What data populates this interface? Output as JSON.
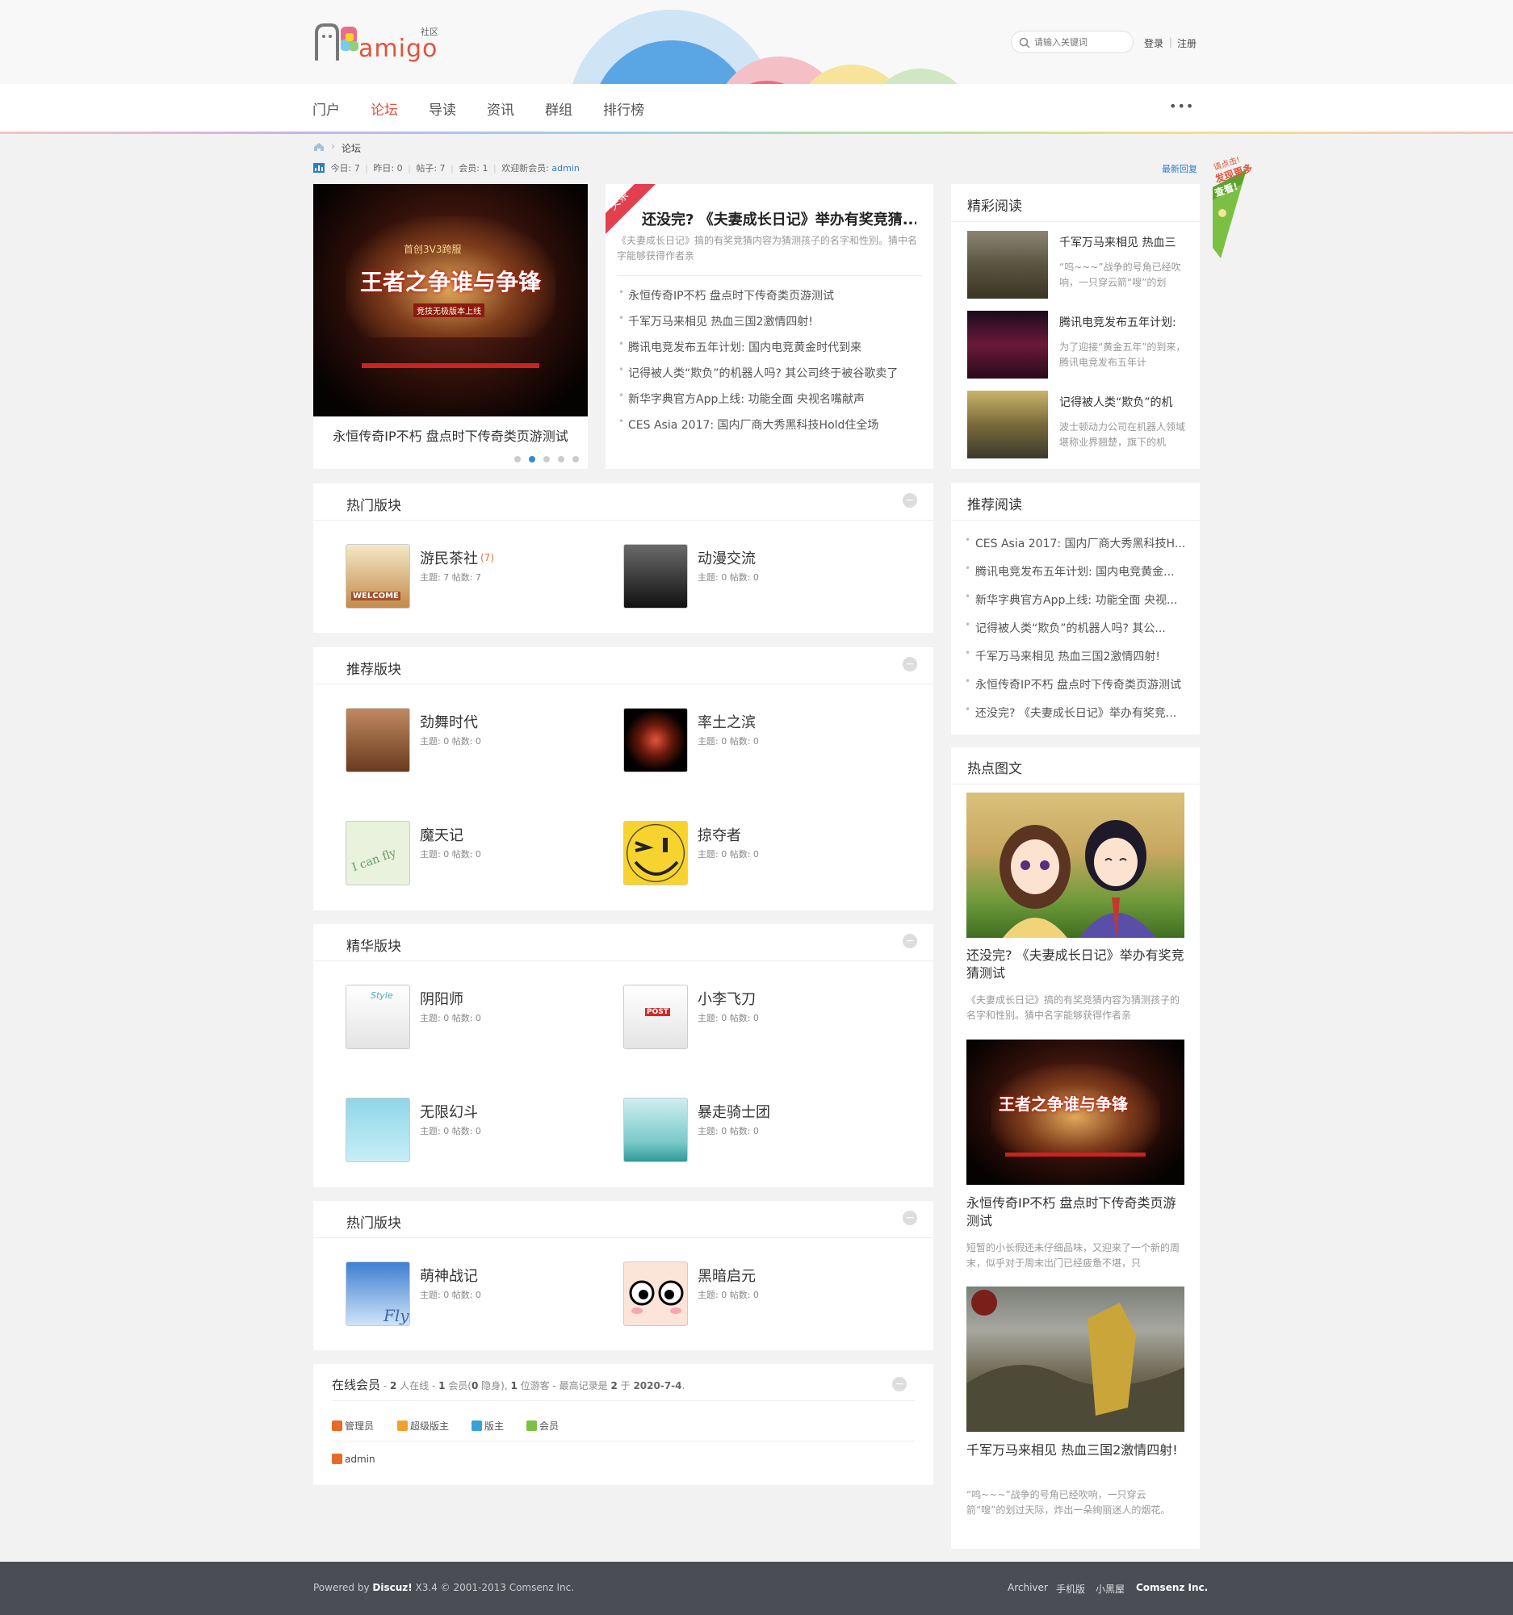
{
  "header": {
    "logo_text": "amigo",
    "logo_sub": "社区",
    "search_placeholder": "请输入关键词",
    "login": "登录",
    "divider": "|",
    "register": "注册"
  },
  "nav": {
    "items": [
      "门户",
      "论坛",
      "导读",
      "资讯",
      "群组",
      "排行榜"
    ],
    "active": "论坛",
    "more": "•••"
  },
  "breadcrumb": {
    "current": "论坛",
    "separator": "›"
  },
  "stats": {
    "text_today": "今日: 7",
    "text_yesterday": "昨日: 0",
    "text_posts": "帖子: 7",
    "text_members": "会员: 1",
    "text_welcome": "欢迎新会员:",
    "new_member": "admin",
    "latest_reply": "最新回复",
    "sep": "|"
  },
  "side_badge": {
    "line1": "请点击!",
    "line2": "发现更多",
    "line3": "查看!"
  },
  "slider": {
    "caption": "永恒传奇IP不朽 盘点时下传奇类页游测试",
    "dots": 5,
    "active_dot": 2,
    "image_title": "首创3V3跨服",
    "image_headline": "王者之争谁与争锋",
    "image_sub": "竞技无极版本上线"
  },
  "headline": {
    "tag": "头条",
    "title": "还没完? 《夫妻成长日记》举办有奖竞猜...",
    "summary": "《夫妻成长日记》搞的有奖竞猜内容为猜测孩子的名字和性别。猜中名字能够获得作者亲",
    "items": [
      "永恒传奇IP不朽 盘点时下传奇类页游测试",
      "千军万马来相见 热血三国2激情四射!",
      "腾讯电竞发布五年计划: 国内电竞黄金时代到来",
      "记得被人类“欺负”的机器人吗? 其公司终于被谷歌卖了",
      "新华字典官方App上线: 功能全面 央视名嘴献声",
      "CES Asia 2017: 国内厂商大秀黑科技Hold住全场"
    ]
  },
  "featured": {
    "title": "精彩阅读",
    "items": [
      {
        "title": "千军万马来相见 热血三",
        "desc": "“呜~~~”战争的号角已经吹响，一只穿云箭“嗖”的划"
      },
      {
        "title": "腾讯电竞发布五年计划:",
        "desc": "为了迎接“黄金五年”的到来，腾讯电竞发布五年计"
      },
      {
        "title": "记得被人类“欺负”的机",
        "desc": "波士顿动力公司在机器人领域堪称业界翘楚，旗下的机"
      }
    ]
  },
  "recommended": {
    "title": "推荐阅读",
    "items": [
      "CES Asia 2017: 国内厂商大秀黑科技H...",
      "腾讯电竞发布五年计划: 国内电竞黄金...",
      "新华字典官方App上线: 功能全面 央视...",
      "记得被人类“欺负”的机器人吗? 其公...",
      "千军万马来相见 热血三国2激情四射!",
      "永恒传奇IP不朽 盘点时下传奇类页游测试",
      "还没完? 《夫妻成长日记》举办有奖竞..."
    ]
  },
  "hotpics": {
    "title": "热点图文",
    "items": [
      {
        "title": "还没完? 《夫妻成长日记》举办有奖竞猜测试",
        "desc": "《夫妻成长日记》搞的有奖竞猜内容为猜测孩子的名字和性别。猜中名字能够获得作者亲"
      },
      {
        "title": "永恒传奇IP不朽 盘点时下传奇类页游测试",
        "desc": "短暂的小长假还未仔细品味，又迎来了一个新的周末，似乎对于周末出门已经疲惫不堪，只"
      },
      {
        "title": "千军万马来相见 热血三国2激情四射!",
        "desc": "“呜~~~”战争的号角已经吹响，一只穿云箭“嗖”的划过天际，炸出一朵绚丽迷人的烟花。"
      }
    ]
  },
  "sections": [
    {
      "title": "热门版块",
      "forums": [
        {
          "name": "游民茶社",
          "count": "(7)",
          "stat": "主题: 7  帖数: 7"
        },
        {
          "name": "动漫交流",
          "stat": "主题: 0  帖数: 0"
        }
      ]
    },
    {
      "title": "推荐版块",
      "forums": [
        {
          "name": "劲舞时代",
          "stat": "主题: 0  帖数: 0"
        },
        {
          "name": "率土之滨",
          "stat": "主题: 0  帖数: 0"
        },
        {
          "name": "魔天记",
          "stat": "主题: 0  帖数: 0"
        },
        {
          "name": "掠夺者",
          "stat": "主题: 0  帖数: 0"
        }
      ]
    },
    {
      "title": "精华版块",
      "forums": [
        {
          "name": "阴阳师",
          "stat": "主题: 0  帖数: 0"
        },
        {
          "name": "小李飞刀",
          "stat": "主题: 0  帖数: 0"
        },
        {
          "name": "无限幻斗",
          "stat": "主题: 0  帖数: 0"
        },
        {
          "name": "暴走骑士团",
          "stat": "主题: 0  帖数: 0"
        }
      ]
    },
    {
      "title": "热门版块",
      "forums": [
        {
          "name": "萌神战记",
          "stat": "主题: 0  帖数: 0"
        },
        {
          "name": "黑暗启元",
          "stat": "主题: 0  帖数: 0"
        }
      ]
    }
  ],
  "online": {
    "title": "在线会员",
    "p1": " - ",
    "n1": "2",
    "p2": " 人在线 - ",
    "n2": "1",
    "p3": " 会员(",
    "n3": "0",
    "p4": " 隐身), ",
    "n4": "1",
    "p5": " 位游客 - 最高记录是 ",
    "n5": "2",
    "p6": " 于 ",
    "date": "2020-7-4",
    "p7": ".",
    "legend": [
      "管理员",
      "超级版主",
      "版主",
      "会员"
    ],
    "members": [
      "admin"
    ]
  },
  "icon_texts": {
    "welcome": "WELCOME",
    "fly": "Fly",
    "post": "POST",
    "icanfly": "I can fly",
    "style": "Style"
  },
  "footer": {
    "powered": "Powered by ",
    "brand": "Discuz!",
    "version": " X3.4",
    "copyright": " © 2001-2013 Comsenz Inc.",
    "links": [
      "Archiver",
      "手机版",
      "小黑屋"
    ],
    "company": "Comsenz Inc."
  }
}
